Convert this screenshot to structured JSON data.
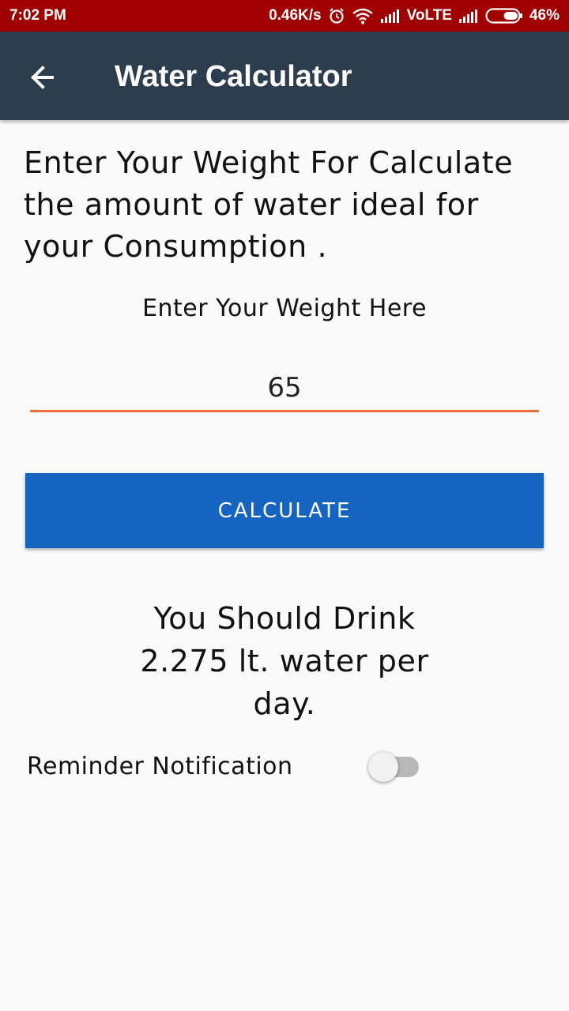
{
  "status_bar": {
    "time": "7:02 PM",
    "speed": "0.46K/s",
    "network": "VoLTE",
    "battery": "46%",
    "battery_level": 0.46,
    "icons": [
      "alarm-icon",
      "wifi-icon",
      "signal-icon",
      "signal-icon",
      "battery-icon"
    ]
  },
  "app_bar": {
    "title": "Water Calculator",
    "back_icon": "arrow-back-icon",
    "background": "#2c3e4d"
  },
  "intro": {
    "text": "Enter Your Weight For Calculate the amount of water ideal for your Consumption ."
  },
  "weight": {
    "label": "Enter Your Weight Here",
    "value": "65",
    "underline_color": "#f26b3a"
  },
  "calculate_button": {
    "label": "CALCULATE",
    "color": "#1565c0"
  },
  "result": {
    "text": "You Should Drink 2.275 lt. water per day."
  },
  "reminder": {
    "label": "Reminder Notification",
    "enabled": false
  }
}
